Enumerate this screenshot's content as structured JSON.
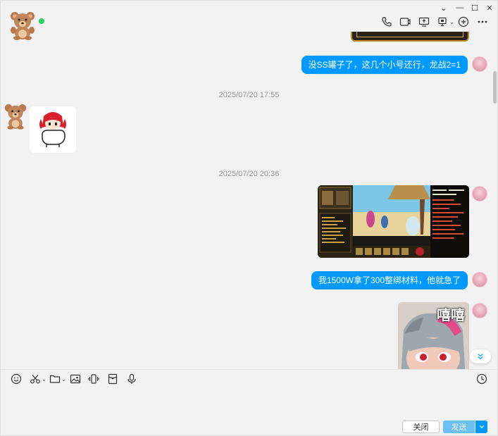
{
  "header": {
    "peer_avatar": "teddy-bear-avatar",
    "online_status_color": "#1ed760",
    "toolbar_icons": [
      "phone-icon",
      "video-icon",
      "screen-share-icon",
      "remote-assist-icon",
      "add-member-icon",
      "more-icon"
    ]
  },
  "window_controls": {
    "dropdown": "⌄",
    "minimize": "—",
    "maximize": "☐",
    "close": "✕"
  },
  "messages": [
    {
      "type": "text",
      "side": "out",
      "text": "没SS罐子了，这几个小号还行，龙战2=1"
    },
    {
      "type": "timestamp",
      "text": "2025/07/20 17:55"
    },
    {
      "type": "sticker",
      "side": "in",
      "desc": "anime-girl-sticker"
    },
    {
      "type": "timestamp",
      "text": "2025/07/20 20:36"
    },
    {
      "type": "image",
      "side": "out",
      "desc": "game-screenshot"
    },
    {
      "type": "text",
      "side": "out",
      "text": "我1500W拿了300整绑材料，他就急了"
    },
    {
      "type": "sticker",
      "side": "out",
      "desc": "meme-sticker",
      "caption": "嘻嘻"
    }
  ],
  "input": {
    "toolbar_icons": [
      "emoji-icon",
      "scissors-icon",
      "folder-icon",
      "image-icon",
      "shake-icon",
      "red-packet-icon",
      "mic-icon",
      "history-icon"
    ],
    "value": ""
  },
  "buttons": {
    "close_label": "关闭",
    "send_label": "发送"
  },
  "colors": {
    "accent": "#0099ff",
    "background": "#f2f2f2"
  }
}
